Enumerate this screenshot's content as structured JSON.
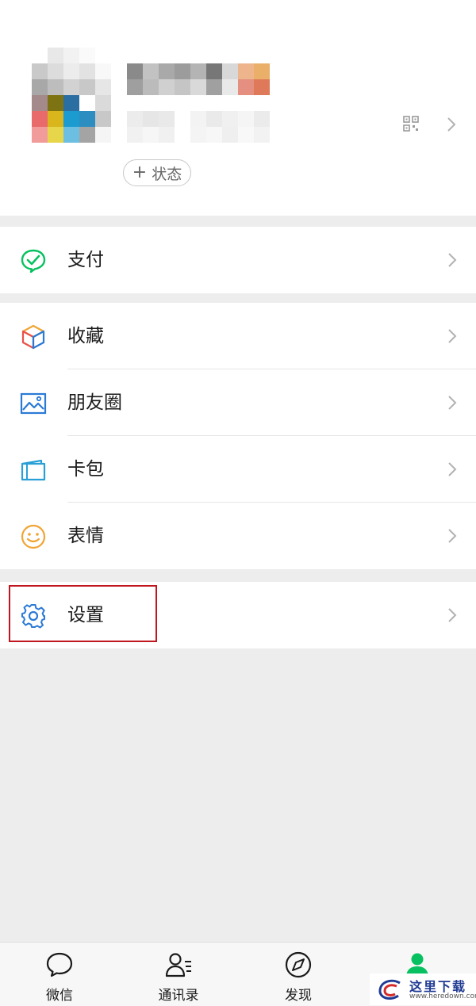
{
  "profile": {
    "status_button_label": "状态",
    "status_plus": "+"
  },
  "menu": {
    "pay": {
      "label": "支付",
      "icon": "pay-icon"
    },
    "items": [
      {
        "label": "收藏",
        "icon": "favorites-cube-icon"
      },
      {
        "label": "朋友圈",
        "icon": "moments-image-icon"
      },
      {
        "label": "卡包",
        "icon": "card-wallet-icon"
      },
      {
        "label": "表情",
        "icon": "sticker-smiley-icon"
      }
    ],
    "settings": {
      "label": "设置",
      "icon": "gear-icon"
    }
  },
  "tabbar": {
    "tabs": [
      {
        "label": "微信",
        "icon": "chat-bubble-icon"
      },
      {
        "label": "通讯录",
        "icon": "contacts-icon"
      },
      {
        "label": "发现",
        "icon": "compass-icon"
      },
      {
        "label": "",
        "icon": "me-person-icon"
      }
    ]
  },
  "watermark": {
    "text": "这里下载",
    "url": "www.heredown.com"
  },
  "colors": {
    "wechat_green": "#07c160",
    "highlight_red": "#c0161d",
    "icon_blue": "#2a7ad5",
    "icon_orange": "#f0a535"
  }
}
